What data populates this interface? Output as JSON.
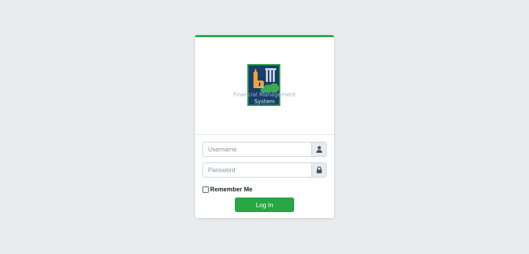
{
  "logo": {
    "caption_line1": "Financial Management",
    "caption_line2": "System",
    "colors": {
      "background": "#183e69",
      "border": "#2ea14a",
      "building": "#f2a23a",
      "columns": "#c8d3e0",
      "hill": "#3aa856"
    }
  },
  "login_form": {
    "username": {
      "value": "",
      "placeholder": "Username",
      "icon": "user-icon"
    },
    "password": {
      "value": "",
      "placeholder": "Password",
      "icon": "lock-icon"
    },
    "remember_me_label": "Remember Me",
    "remember_me_checked": false,
    "login_button_label": "Log In"
  },
  "colors": {
    "page_background": "#e9ecef",
    "accent": "#28a745"
  }
}
